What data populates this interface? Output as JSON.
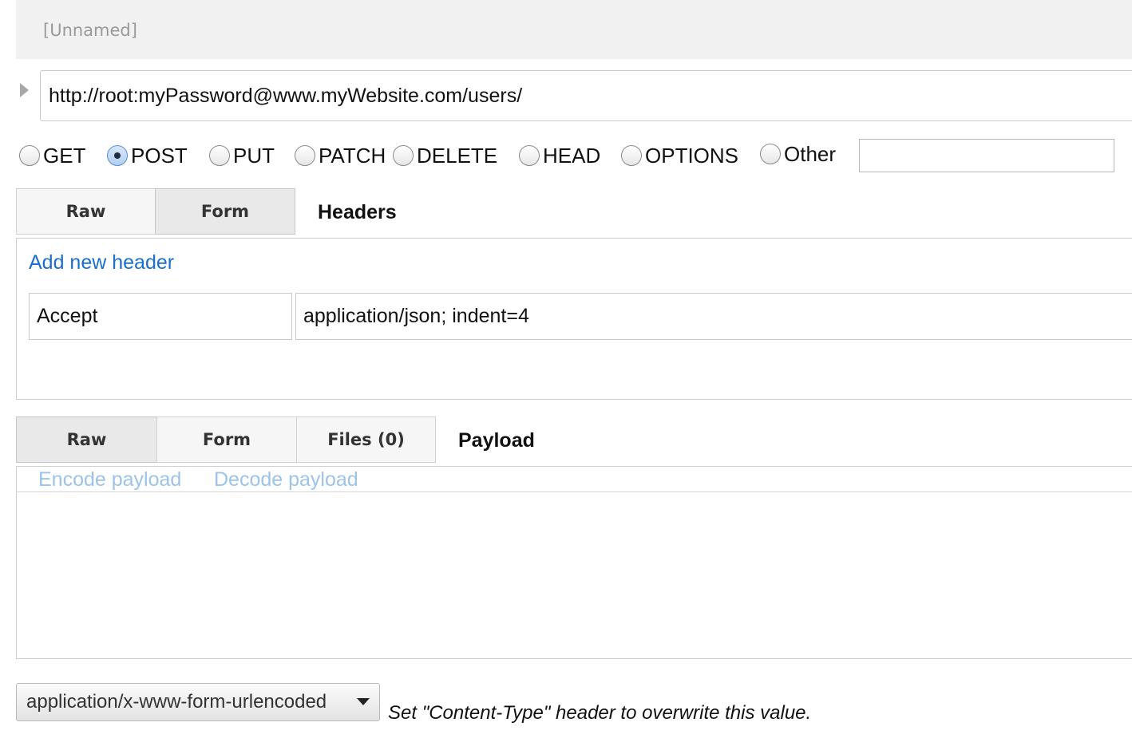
{
  "request": {
    "name": "[Unnamed]",
    "url": "http://root:myPassword@www.myWebsite.com/users/"
  },
  "methods": {
    "options": [
      "GET",
      "POST",
      "PUT",
      "PATCH",
      "DELETE",
      "HEAD",
      "OPTIONS",
      "Other"
    ],
    "selected": "POST",
    "other_value": ""
  },
  "headers": {
    "tabs": [
      "Raw",
      "Form"
    ],
    "active_tab": "Form",
    "section_label": "Headers",
    "add_link": "Add new header",
    "rows": [
      {
        "name": "Accept",
        "value": "application/json; indent=4"
      }
    ]
  },
  "payload": {
    "tabs": [
      "Raw",
      "Form",
      "Files (0)"
    ],
    "active_tab": "Raw",
    "section_label": "Payload",
    "encode_link": "Encode payload",
    "decode_link": "Decode payload",
    "body": ""
  },
  "content_type": {
    "selected": "application/x-www-form-urlencoded",
    "hint": "Set \"Content-Type\" header to overwrite this value."
  },
  "icons": {
    "expand": "triangle-right-icon",
    "dropdown": "caret-down-icon"
  }
}
